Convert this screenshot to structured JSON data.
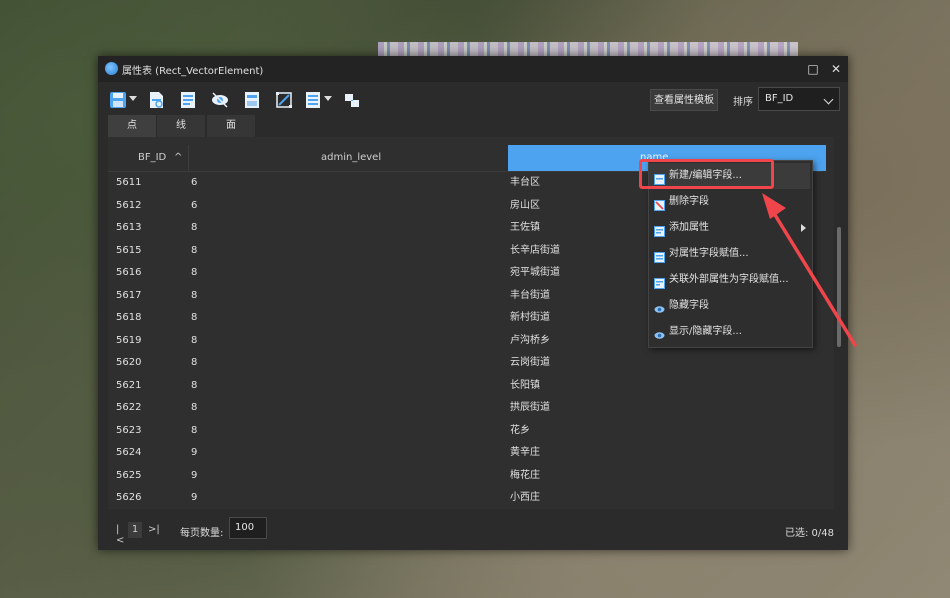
{
  "window": {
    "title": "属性表 (Rect_VectorElement)",
    "maximize_icon": "□",
    "close_icon": "✕"
  },
  "toolbar": {
    "icons": [
      "save-icon",
      "new-field-icon",
      "attribute-icon",
      "visibility-icon",
      "edit-icon",
      "zoom-extent-icon",
      "list-icon",
      "layers-icon"
    ],
    "view_template_label": "查看属性模板",
    "sort_label": "排序",
    "sort_value": "BF_ID"
  },
  "tabs": [
    {
      "label": "点"
    },
    {
      "label": "线"
    },
    {
      "label": "面"
    }
  ],
  "table": {
    "columns": [
      "BF_ID",
      "admin_level",
      "name"
    ],
    "sort_indicator": "^",
    "rows": [
      {
        "id": "5611",
        "level": "6",
        "name": "丰台区"
      },
      {
        "id": "5612",
        "level": "6",
        "name": "房山区"
      },
      {
        "id": "5613",
        "level": "8",
        "name": "王佐镇"
      },
      {
        "id": "5615",
        "level": "8",
        "name": "长辛店街道"
      },
      {
        "id": "5616",
        "level": "8",
        "name": "宛平城街道"
      },
      {
        "id": "5617",
        "level": "8",
        "name": "丰台街道"
      },
      {
        "id": "5618",
        "level": "8",
        "name": "新村街道"
      },
      {
        "id": "5619",
        "level": "8",
        "name": "卢沟桥乡"
      },
      {
        "id": "5620",
        "level": "8",
        "name": "云岗街道"
      },
      {
        "id": "5621",
        "level": "8",
        "name": "长阳镇"
      },
      {
        "id": "5622",
        "level": "8",
        "name": "拱辰街道"
      },
      {
        "id": "5623",
        "level": "8",
        "name": "花乡"
      },
      {
        "id": "5624",
        "level": "9",
        "name": "黄辛庄"
      },
      {
        "id": "5625",
        "level": "9",
        "name": "梅花庄"
      },
      {
        "id": "5626",
        "level": "9",
        "name": "小西庄"
      }
    ]
  },
  "context_menu": {
    "items": [
      {
        "label": "新建/编辑字段...",
        "icon": "field-edit-icon"
      },
      {
        "label": "删除字段",
        "icon": "delete-field-icon"
      },
      {
        "label": "添加属性",
        "icon": "add-attribute-icon"
      },
      {
        "label": "对属性字段赋值...",
        "icon": "assign-value-icon"
      },
      {
        "label": "关联外部属性为字段赋值...",
        "icon": "link-external-icon"
      },
      {
        "label": "隐藏字段",
        "icon": "eye-icon"
      },
      {
        "label": "显示/隐藏字段...",
        "icon": "eye-icon"
      }
    ]
  },
  "footer": {
    "first_page": "|<",
    "page": "1",
    "next_page": ">|",
    "per_page_label": "每页数量:",
    "per_page_value": "100",
    "selected_text": "已选: 0/48"
  },
  "colors": {
    "accent": "#4da3ef",
    "highlight": "#f0454a",
    "window_bg": "#2b2b2b"
  }
}
